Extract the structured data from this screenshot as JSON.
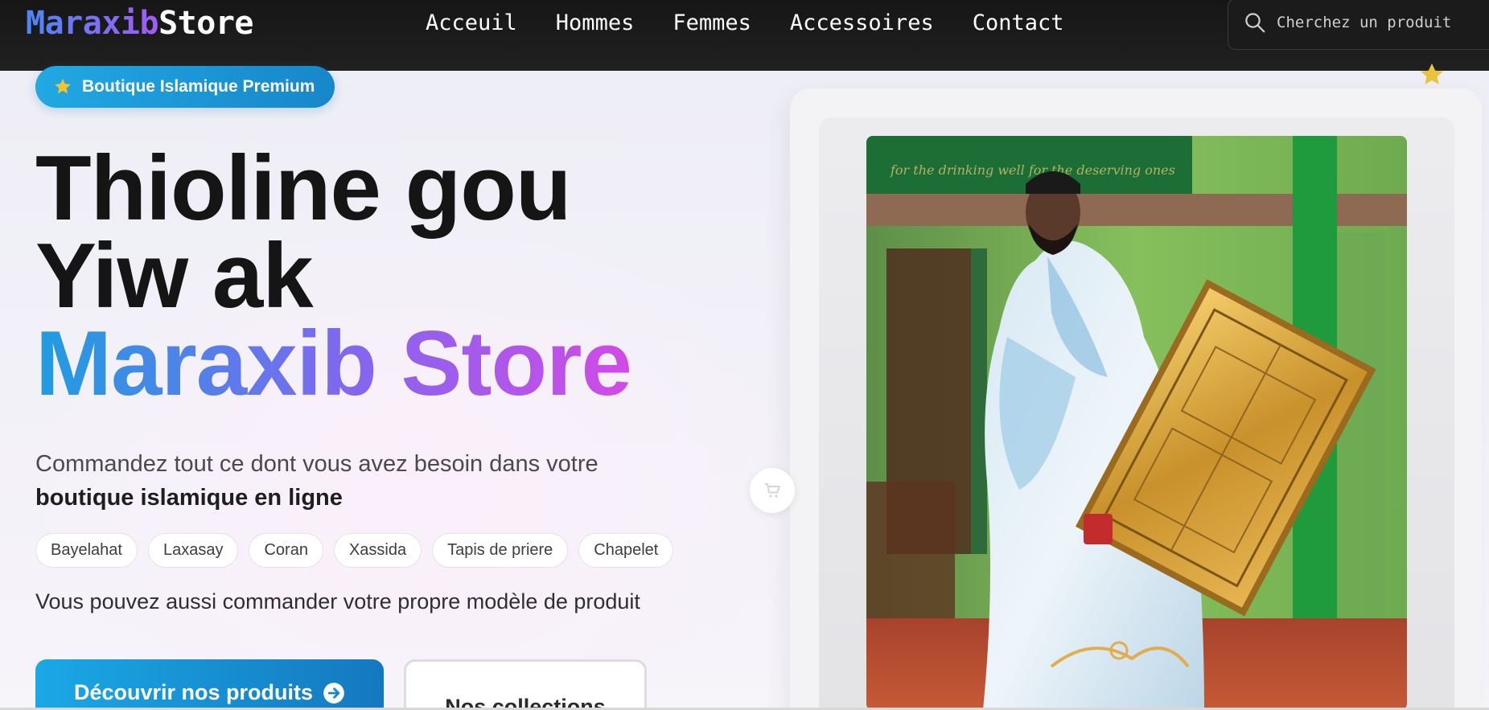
{
  "navbar": {
    "logo_a": "Maraxib",
    "logo_b": "Store",
    "links": [
      "Acceuil",
      "Hommes",
      "Femmes",
      "Accessoires",
      "Contact"
    ],
    "search_placeholder": "Cherchez un produit"
  },
  "hero": {
    "badge": "Boutique Islamique Premium",
    "title_line1": "Thioline gou",
    "title_line2": "Yiw ak",
    "title_line3": "Maraxib Store",
    "lead_line1": "Commandez tout ce dont vous avez besoin dans votre",
    "lead_line2": "boutique islamique en ligne",
    "tags": [
      "Bayelahat",
      "Laxasay",
      "Coran",
      "Xassida",
      "Tapis de priere",
      "Chapelet"
    ],
    "custom_note": "Vous pouvez aussi commander votre propre modèle de produit",
    "cta_primary": "Découvrir nos produits",
    "cta_secondary": "Nos collections"
  },
  "icons": {
    "search": "search-icon",
    "badge_star": "star-icon",
    "cta_arrow": "arrow-right-circle-icon",
    "cart": "cart-icon"
  },
  "colors": {
    "nav_bg": "#1a1a1a",
    "accent_blue": "#1aa8e6",
    "accent_purple": "#a25cf2",
    "accent_pink": "#d24ae6",
    "star_gold": "#f2c230"
  }
}
